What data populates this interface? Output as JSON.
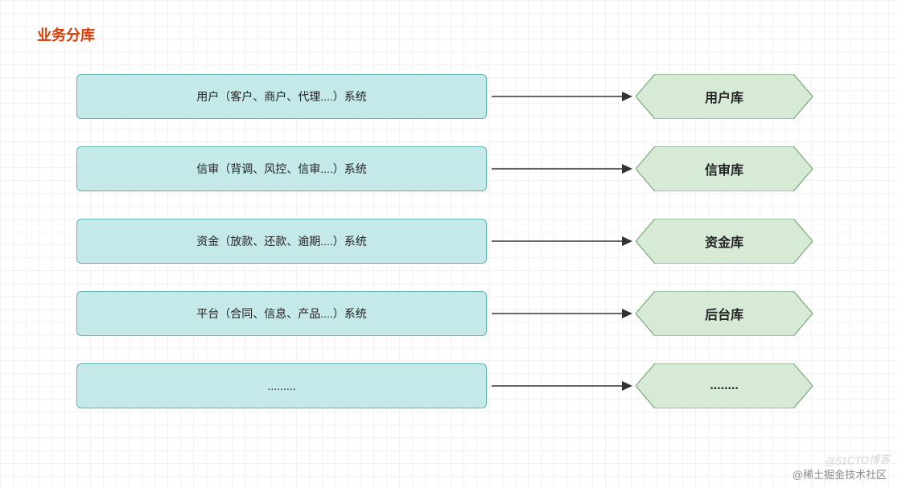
{
  "title": "业务分库",
  "rows": [
    {
      "system": "用户（客户、商户、代理....）系统",
      "db": "用户库"
    },
    {
      "system": "信审（背调、风控、信审....）系统",
      "db": "信审库"
    },
    {
      "system": "资金（放款、还款、逾期....）系统",
      "db": "资金库"
    },
    {
      "system": "平台（合同、信息、产品....）系统",
      "db": "后台库"
    },
    {
      "system": ".........",
      "db": "........"
    }
  ],
  "watermark1": "@稀土掘金技术社区",
  "watermark2": "@51CTO博客",
  "colors": {
    "title": "#d83b01",
    "system_fill": "#c5e8e8",
    "system_stroke": "#5fb3b3",
    "db_fill": "#d6ead6",
    "db_stroke": "#7aa77a",
    "arrow": "#333333"
  }
}
